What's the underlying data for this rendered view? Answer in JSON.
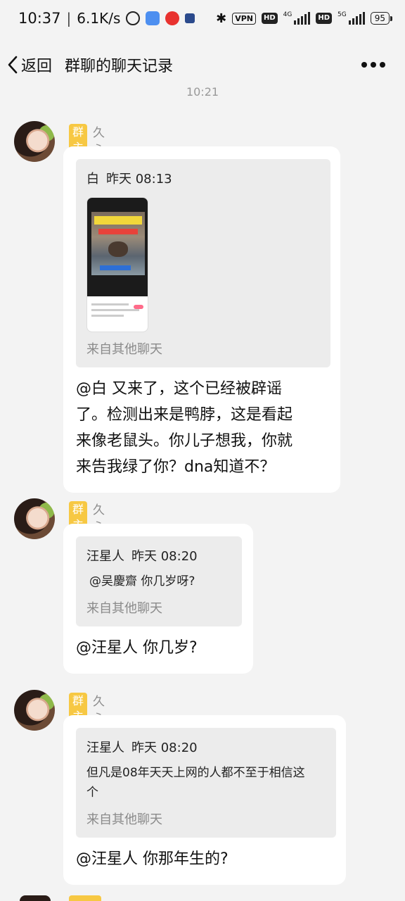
{
  "status_bar": {
    "time": "10:37",
    "separator": "|",
    "speed": "6.1K/s",
    "vpn": "VPN",
    "hd1": "HD",
    "net1": "4G",
    "hd2": "HD",
    "net2": "5G",
    "battery": "95"
  },
  "nav": {
    "back_label": "返回",
    "title": "群聊的聊天记录"
  },
  "timestamp": "10:21",
  "messages": [
    {
      "badge": "群主",
      "sender": "久永",
      "quote": {
        "author": "白",
        "time": "昨天 08:13",
        "source": "来自其他聊天"
      },
      "reply_lines": [
        "@白 又来了，这个已经被辟谣",
        "了。检测出来是鸭脖，这是看起",
        "来像老鼠头。你儿子想我，你就",
        "来告我绿了你？dna知道不？"
      ]
    },
    {
      "badge": "群主",
      "sender": "久永",
      "quote": {
        "author": "汪星人",
        "time": "昨天 08:20",
        "text": "@吴慶齋 你几岁呀?",
        "source": "来自其他聊天"
      },
      "reply": "@汪星人 你几岁?"
    },
    {
      "badge": "群主",
      "sender": "久永",
      "quote": {
        "author": "汪星人",
        "time": "昨天 08:20",
        "text_lines": [
          "但凡是08年天天上网的人都不至于相信这",
          "个"
        ],
        "source": "来自其他聊天"
      },
      "reply": "@汪星人 你那年生的?"
    }
  ]
}
